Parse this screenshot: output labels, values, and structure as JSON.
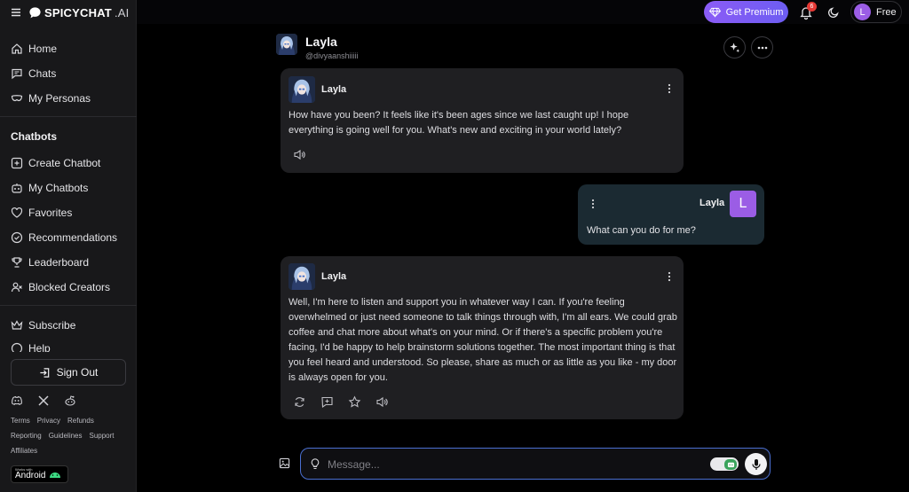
{
  "brand": {
    "name": "SPICYCHAT",
    "suffix": ".AI"
  },
  "nav": {
    "home": "Home",
    "chats": "Chats",
    "personas": "My Personas",
    "section_title": "Chatbots",
    "create": "Create Chatbot",
    "my_chatbots": "My Chatbots",
    "favorites": "Favorites",
    "recommendations": "Recommendations",
    "leaderboard": "Leaderboard",
    "blocked": "Blocked Creators",
    "subscribe": "Subscribe",
    "help": "Help"
  },
  "signout": "Sign Out",
  "footer_links": {
    "row1": [
      "Terms",
      "Privacy",
      "Refunds"
    ],
    "row2": [
      "Reporting",
      "Guidelines",
      "Support"
    ],
    "row3": [
      "Affiliates"
    ]
  },
  "android": {
    "small": "Works with",
    "big": "Android"
  },
  "topbar": {
    "premium": "Get Premium",
    "notif_count": "6",
    "user_initial": "L",
    "plan": "Free"
  },
  "character": {
    "name": "Layla",
    "handle": "@divyaanshiiiii"
  },
  "messages": [
    {
      "sender": "Layla",
      "text": "How have you been? It feels like it's been ages since we last caught up! I hope everything is going well for you. What's new and exciting in your world lately?"
    },
    {
      "sender": "Layla",
      "initial": "L",
      "text": "What can you do for me?"
    },
    {
      "sender": "Layla",
      "text": "Well, I'm here to listen and support you in whatever way I can. If you're feeling overwhelmed or just need someone to talk things through with, I'm all ears. We could grab coffee and chat more about what's on your mind. Or if there's a specific problem you're facing, I'd be happy to help brainstorm solutions together. The most important thing is that you feel heard and understood. So please, share as much or as little as you like - my door is always open for you."
    }
  ],
  "composer": {
    "placeholder": "Message..."
  },
  "colors": {
    "accent": "#8b5cf6",
    "user_bubble": "#1b2a32",
    "bot_bubble": "#1f1f22",
    "composer_border": "#4a6fd1"
  }
}
